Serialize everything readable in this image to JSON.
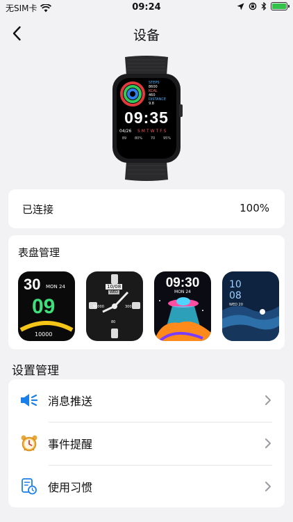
{
  "status_bar": {
    "carrier": "无SIM卡",
    "time": "09:24",
    "battery_level": 1.0
  },
  "nav": {
    "title": "设备"
  },
  "watch_preview": {
    "steps_label": "STEPS",
    "steps_value": "8600",
    "kcal_label": "KCAL",
    "kcal_value": "460",
    "distance_label": "DISTANCE",
    "distance_value": "9.8",
    "time": "09:35",
    "date": "04/26",
    "weekdays": "SMTWTFS",
    "stats": [
      "89",
      "80%",
      "70",
      "95%"
    ]
  },
  "connection": {
    "status": "已连接",
    "battery": "100%"
  },
  "watch_faces": {
    "title": "表盘管理",
    "faces": [
      {
        "name": "face-1",
        "big_time": "30",
        "date": "MON 24",
        "digits": "09",
        "steps": "10000"
      },
      {
        "name": "face-2",
        "date_box": "10/08",
        "wed": "WED",
        "v1": "90000",
        "v2": "300",
        "v3": "80"
      },
      {
        "name": "face-3",
        "time": "09:30",
        "date": "MON 24"
      },
      {
        "name": "face-4",
        "hour": "10",
        "minute": "08",
        "date": "WED 20"
      }
    ]
  },
  "settings": {
    "section_title": "设置管理",
    "items": [
      {
        "label": "消息推送",
        "icon": "speaker-icon"
      },
      {
        "label": "事件提醒",
        "icon": "alarm-clock-icon"
      },
      {
        "label": "使用习惯",
        "icon": "document-clock-icon"
      }
    ]
  },
  "colors": {
    "accent_blue": "#1a7fe8",
    "card_bg": "#ffffff",
    "page_bg": "#f2f2f5"
  }
}
